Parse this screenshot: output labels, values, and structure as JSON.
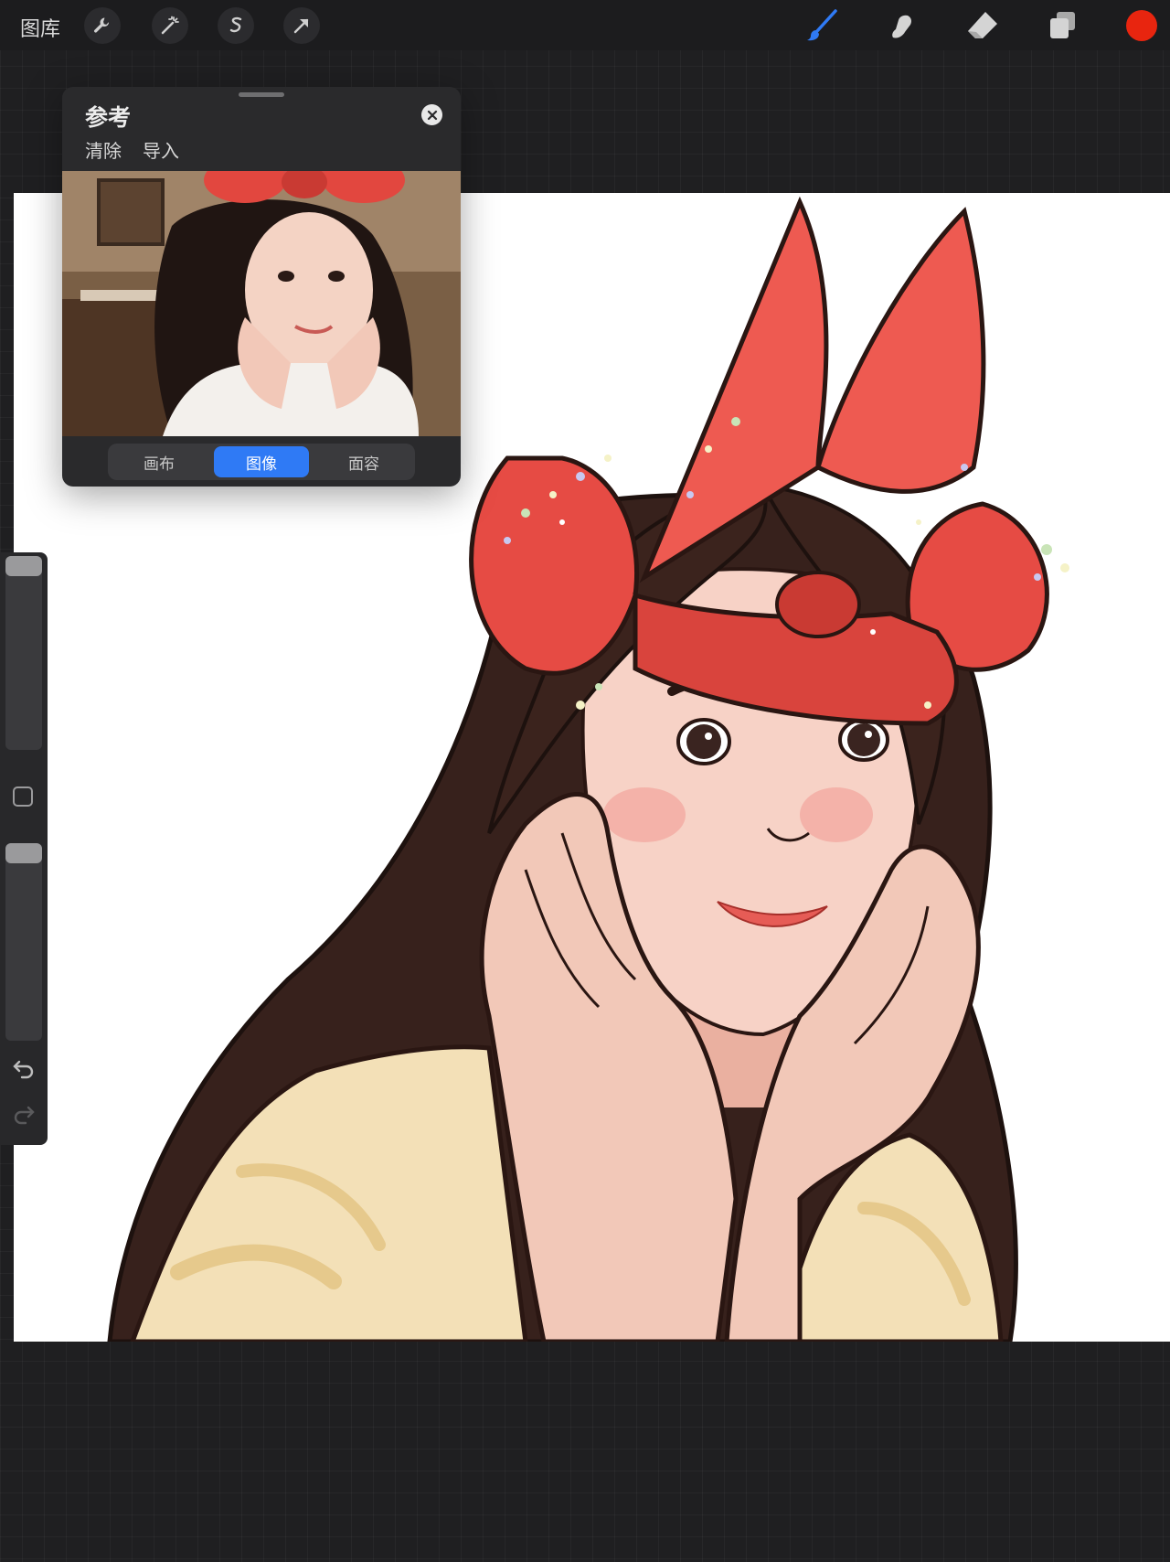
{
  "topbar": {
    "gallery_label": "图库",
    "left_tools": [
      {
        "name": "actions",
        "icon": "wrench-icon"
      },
      {
        "name": "adjustments",
        "icon": "magic-wand-icon"
      },
      {
        "name": "selection",
        "icon": "selection-s-icon"
      },
      {
        "name": "transform",
        "icon": "arrow-cursor-icon"
      }
    ],
    "right_tools": [
      {
        "name": "brush",
        "icon": "brush-icon",
        "active": true
      },
      {
        "name": "smudge",
        "icon": "smudge-icon"
      },
      {
        "name": "eraser",
        "icon": "eraser-icon"
      },
      {
        "name": "layers",
        "icon": "layers-icon"
      },
      {
        "name": "color",
        "icon": "color-swatch",
        "value": "#e8250f"
      }
    ],
    "active_color": "#2f7af5"
  },
  "reference_panel": {
    "title": "参考",
    "actions": [
      "清除",
      "导入"
    ],
    "segments": [
      "画布",
      "图像",
      "面容"
    ],
    "selected_segment": "图像"
  },
  "sidebar": {
    "brush_size_level": 0.0,
    "opacity_level": 0.0,
    "modify_button": "square-icon",
    "undo": "undo-icon",
    "redo": "redo-icon"
  }
}
